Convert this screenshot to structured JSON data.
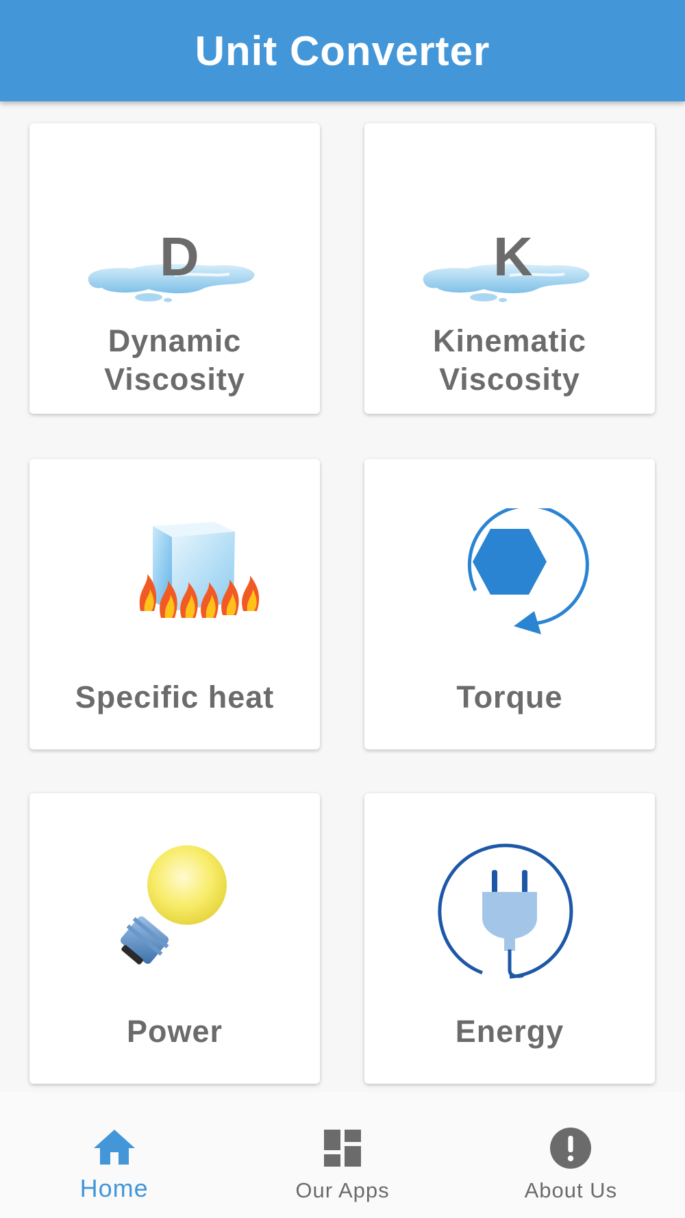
{
  "app_bar": {
    "title": "Unit Converter"
  },
  "colors": {
    "primary": "#4396d8",
    "label_gray": "#6b6b6b",
    "background": "#f7f7f7"
  },
  "cards": [
    {
      "icon": "dynamic-viscosity-icon",
      "label_line1": "Dynamic",
      "label_line2": "Viscosity",
      "letter": "D"
    },
    {
      "icon": "kinematic-viscosity-icon",
      "label_line1": "Kinematic",
      "label_line2": "Viscosity",
      "letter": "K"
    },
    {
      "icon": "specific-heat-icon",
      "label": "Specific heat"
    },
    {
      "icon": "torque-icon",
      "label": "Torque"
    },
    {
      "icon": "power-icon",
      "label": "Power"
    },
    {
      "icon": "energy-icon",
      "label": "Energy"
    }
  ],
  "bottom_nav": {
    "items": [
      {
        "icon": "home-icon",
        "label": "Home",
        "active": true
      },
      {
        "icon": "apps-grid-icon",
        "label": "Our Apps",
        "active": false
      },
      {
        "icon": "info-alert-icon",
        "label": "About Us",
        "active": false
      }
    ]
  }
}
